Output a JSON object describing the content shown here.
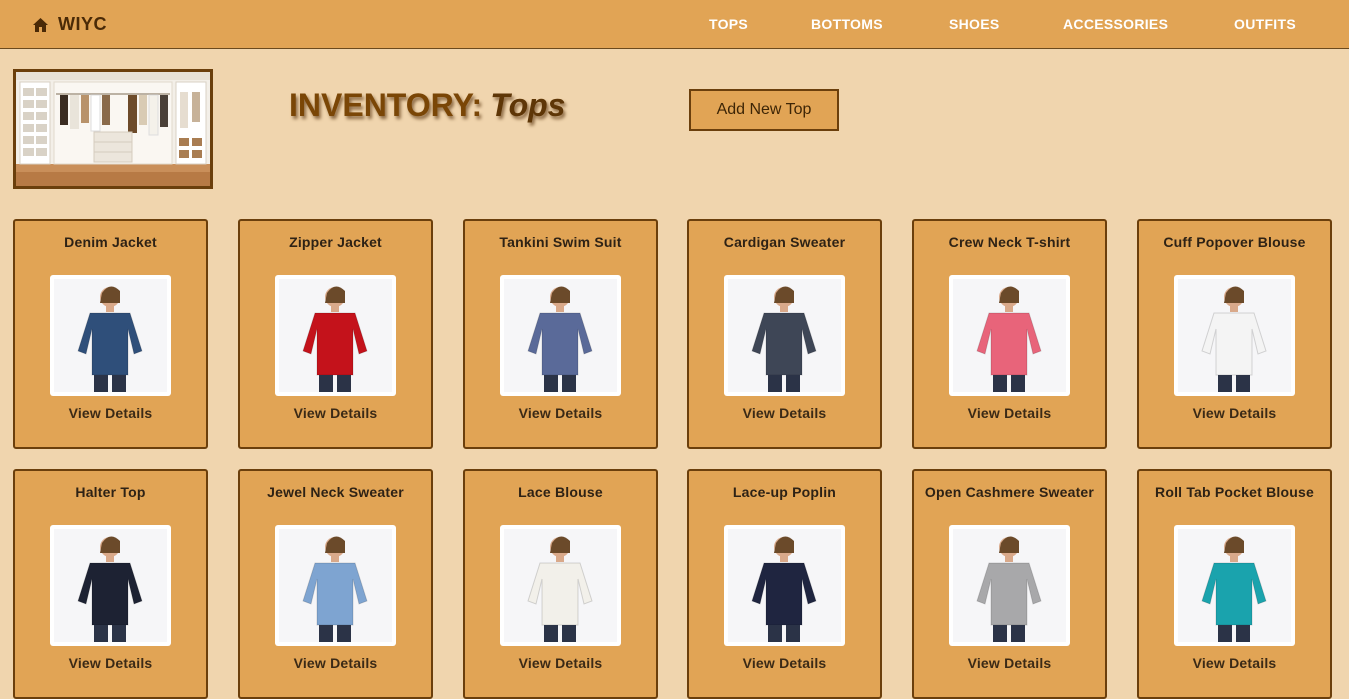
{
  "nav": {
    "brand": "WIYC",
    "links": [
      "TOPS",
      "BOTTOMS",
      "SHOES",
      "ACCESSORIES",
      "OUTFITS"
    ]
  },
  "header": {
    "title_prefix": "INVENTORY:",
    "title_category": "Tops",
    "add_button": "Add New Top"
  },
  "items": [
    {
      "name": "Denim Jacket",
      "action": "View Details",
      "color": "#2f4f7a"
    },
    {
      "name": "Zipper Jacket",
      "action": "View Details",
      "color": "#c4121b"
    },
    {
      "name": "Tankini Swim Suit",
      "action": "View Details",
      "color": "#5a6a99"
    },
    {
      "name": "Cardigan Sweater",
      "action": "View Details",
      "color": "#3e4656"
    },
    {
      "name": "Crew Neck T-shirt",
      "action": "View Details",
      "color": "#e8647a"
    },
    {
      "name": "Cuff Popover Blouse",
      "action": "View Details",
      "color": "#f4f4f4"
    },
    {
      "name": "Halter Top",
      "action": "View Details",
      "color": "#1d2233"
    },
    {
      "name": "Jewel Neck Sweater",
      "action": "View Details",
      "color": "#7ea4d1"
    },
    {
      "name": "Lace Blouse",
      "action": "View Details",
      "color": "#f2f0ea"
    },
    {
      "name": "Lace-up Poplin",
      "action": "View Details",
      "color": "#1f2540"
    },
    {
      "name": "Open Cashmere Sweater",
      "action": "View Details",
      "color": "#a8a8aa"
    },
    {
      "name": "Roll Tab Pocket Blouse",
      "action": "View Details",
      "color": "#1aa3ad"
    }
  ]
}
